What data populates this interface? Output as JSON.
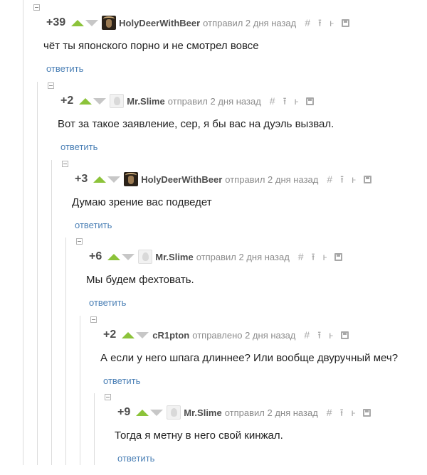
{
  "comments": [
    {
      "rating": "+39",
      "author": "HolyDeerWithBeer",
      "avatar": "deer",
      "meta": "отправил 2 дня назад",
      "text": "чёт ты японского порно и не смотрел вовсе",
      "reply": "ответить"
    },
    {
      "rating": "+2",
      "author": "Mr.Slime",
      "avatar": "slime",
      "meta": "отправил 2 дня назад",
      "text": "Вот за такое заявление, сер, я бы вас на дуэль вызвал.",
      "reply": "ответить"
    },
    {
      "rating": "+3",
      "author": "HolyDeerWithBeer",
      "avatar": "deer",
      "meta": "отправил 2 дня назад",
      "text": "Думаю зрение вас подведет",
      "reply": "ответить"
    },
    {
      "rating": "+6",
      "author": "Mr.Slime",
      "avatar": "slime",
      "meta": "отправил 2 дня назад",
      "text": "Мы будем фехтовать.",
      "reply": "ответить"
    },
    {
      "rating": "+2",
      "author": "cR1pton",
      "avatar": "none",
      "meta": "отправлено 2 дня назад",
      "text": "А если у него шпага длиннее? Или вообще двуручный меч?",
      "reply": "ответить"
    },
    {
      "rating": "+9",
      "author": "Mr.Slime",
      "avatar": "slime",
      "meta": "отправил 2 дня назад",
      "text": "Тогда я метну в него свой кинжал.",
      "reply": "ответить"
    }
  ],
  "tool_glyphs": {
    "link": "#",
    "parent": "⭱",
    "branch": "ⱶ"
  },
  "colors": {
    "upvote": "#8cc33a",
    "downvote": "#c7c7c7",
    "reply_link": "#4a7fb5",
    "rating": "#4d4d4d",
    "meta": "#8b8b8b"
  }
}
